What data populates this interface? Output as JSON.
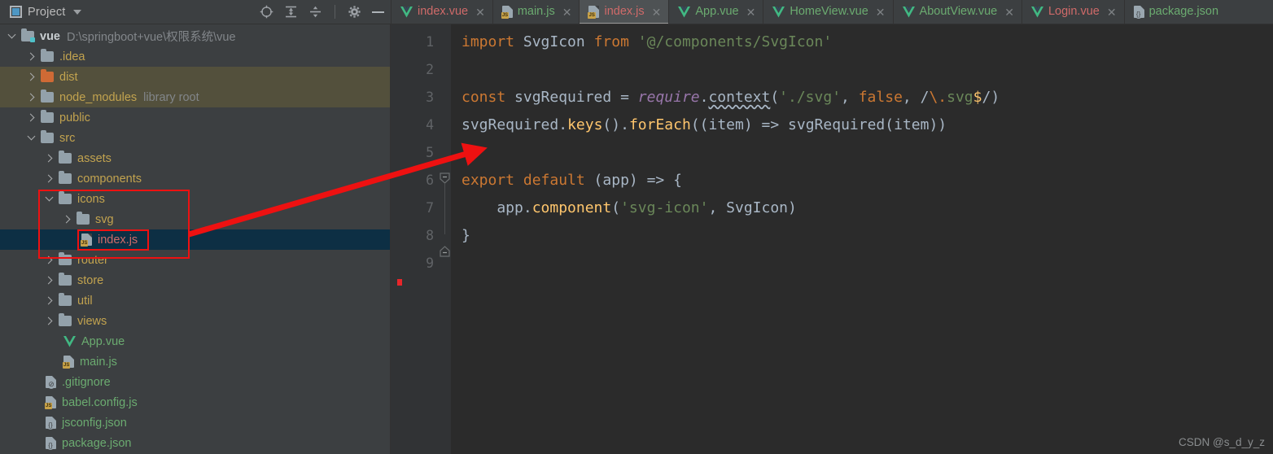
{
  "window": {
    "theme_accent": "#4e97c4",
    "annotation_color": "#ee1111",
    "watermark": "CSDN @s_d_y_z"
  },
  "project_panel": {
    "title": "Project",
    "caret_icon": "chevron-down-icon",
    "panel_icon": "project-panel-icon",
    "toolbar": [
      {
        "name": "locate-icon",
        "label": ""
      },
      {
        "name": "expand-all-icon",
        "label": ""
      },
      {
        "name": "collapse-all-icon",
        "label": ""
      },
      {
        "name": "settings-gear-icon",
        "label": ""
      },
      {
        "name": "hide-panel-icon",
        "label": ""
      }
    ],
    "root": {
      "label": "vue",
      "path": "D:\\springboot+vue\\权限系统\\vue"
    },
    "items": [
      {
        "label": ".idea",
        "kind": "folder",
        "indent": 1,
        "arrow": "right"
      },
      {
        "label": "dist",
        "kind": "folder-orange",
        "indent": 1,
        "arrow": "right",
        "state": "excluded"
      },
      {
        "label": "node_modules",
        "kind": "folder",
        "indent": 1,
        "arrow": "right",
        "state": "excluded",
        "note": "library root"
      },
      {
        "label": "public",
        "kind": "folder",
        "indent": 1,
        "arrow": "right"
      },
      {
        "label": "src",
        "kind": "folder-source",
        "indent": 1,
        "arrow": "down"
      },
      {
        "label": "assets",
        "kind": "folder",
        "indent": 2,
        "arrow": "right"
      },
      {
        "label": "components",
        "kind": "folder",
        "indent": 2,
        "arrow": "right"
      },
      {
        "label": "icons",
        "kind": "folder",
        "indent": 2,
        "arrow": "down"
      },
      {
        "label": "svg",
        "kind": "folder",
        "indent": 3,
        "arrow": "right"
      },
      {
        "label": "index.js",
        "kind": "js",
        "indent": 4,
        "arrow": "none",
        "state": "selected"
      },
      {
        "label": "router",
        "kind": "folder",
        "indent": 2,
        "arrow": "right"
      },
      {
        "label": "store",
        "kind": "folder",
        "indent": 2,
        "arrow": "right"
      },
      {
        "label": "util",
        "kind": "folder",
        "indent": 2,
        "arrow": "right"
      },
      {
        "label": "views",
        "kind": "folder",
        "indent": 2,
        "arrow": "right"
      },
      {
        "label": "App.vue",
        "kind": "vue",
        "indent": 3,
        "arrow": "none"
      },
      {
        "label": "main.js",
        "kind": "js",
        "indent": 3,
        "arrow": "none"
      },
      {
        "label": ".gitignore",
        "kind": "gitignore",
        "indent": 2,
        "arrow": "none"
      },
      {
        "label": "babel.config.js",
        "kind": "js",
        "indent": 2,
        "arrow": "none"
      },
      {
        "label": "jsconfig.json",
        "kind": "json",
        "indent": 2,
        "arrow": "none"
      },
      {
        "label": "package.json",
        "kind": "json",
        "indent": 2,
        "arrow": "none"
      }
    ]
  },
  "tabs": [
    {
      "label": "index.vue",
      "icon": "vue-file-icon",
      "color": "red",
      "active": false,
      "close_icon": "close-icon"
    },
    {
      "label": "main.js",
      "icon": "js-file-icon",
      "color": "green",
      "active": false,
      "close_icon": "close-icon"
    },
    {
      "label": "index.js",
      "icon": "js-file-icon",
      "color": "red",
      "active": true,
      "close_icon": "close-icon"
    },
    {
      "label": "App.vue",
      "icon": "vue-file-icon",
      "color": "green",
      "active": false,
      "close_icon": "close-icon"
    },
    {
      "label": "HomeView.vue",
      "icon": "vue-file-icon",
      "color": "green",
      "active": false,
      "close_icon": "close-icon"
    },
    {
      "label": "AboutView.vue",
      "icon": "vue-file-icon",
      "color": "green",
      "active": false,
      "close_icon": "close-icon"
    },
    {
      "label": "Login.vue",
      "icon": "vue-file-icon",
      "color": "red",
      "active": false,
      "close_icon": "close-icon"
    },
    {
      "label": "package.json",
      "icon": "json-file-icon",
      "color": "green",
      "active": false,
      "close_icon": "none"
    }
  ],
  "editor": {
    "line_numbers": [
      "1",
      "2",
      "3",
      "4",
      "5",
      "6",
      "7",
      "8",
      "9"
    ],
    "error_marker": "error-stripe",
    "lines": [
      "import SvgIcon from '@/components/SvgIcon'",
      "",
      "const svgRequired = require.context('./svg', false, /\\.svg$/)",
      "svgRequired.keys().forEach((item) => svgRequired(item))",
      "",
      "export default (app) => {",
      "    app.component('svg-icon', SvgIcon)",
      "}",
      ""
    ]
  }
}
